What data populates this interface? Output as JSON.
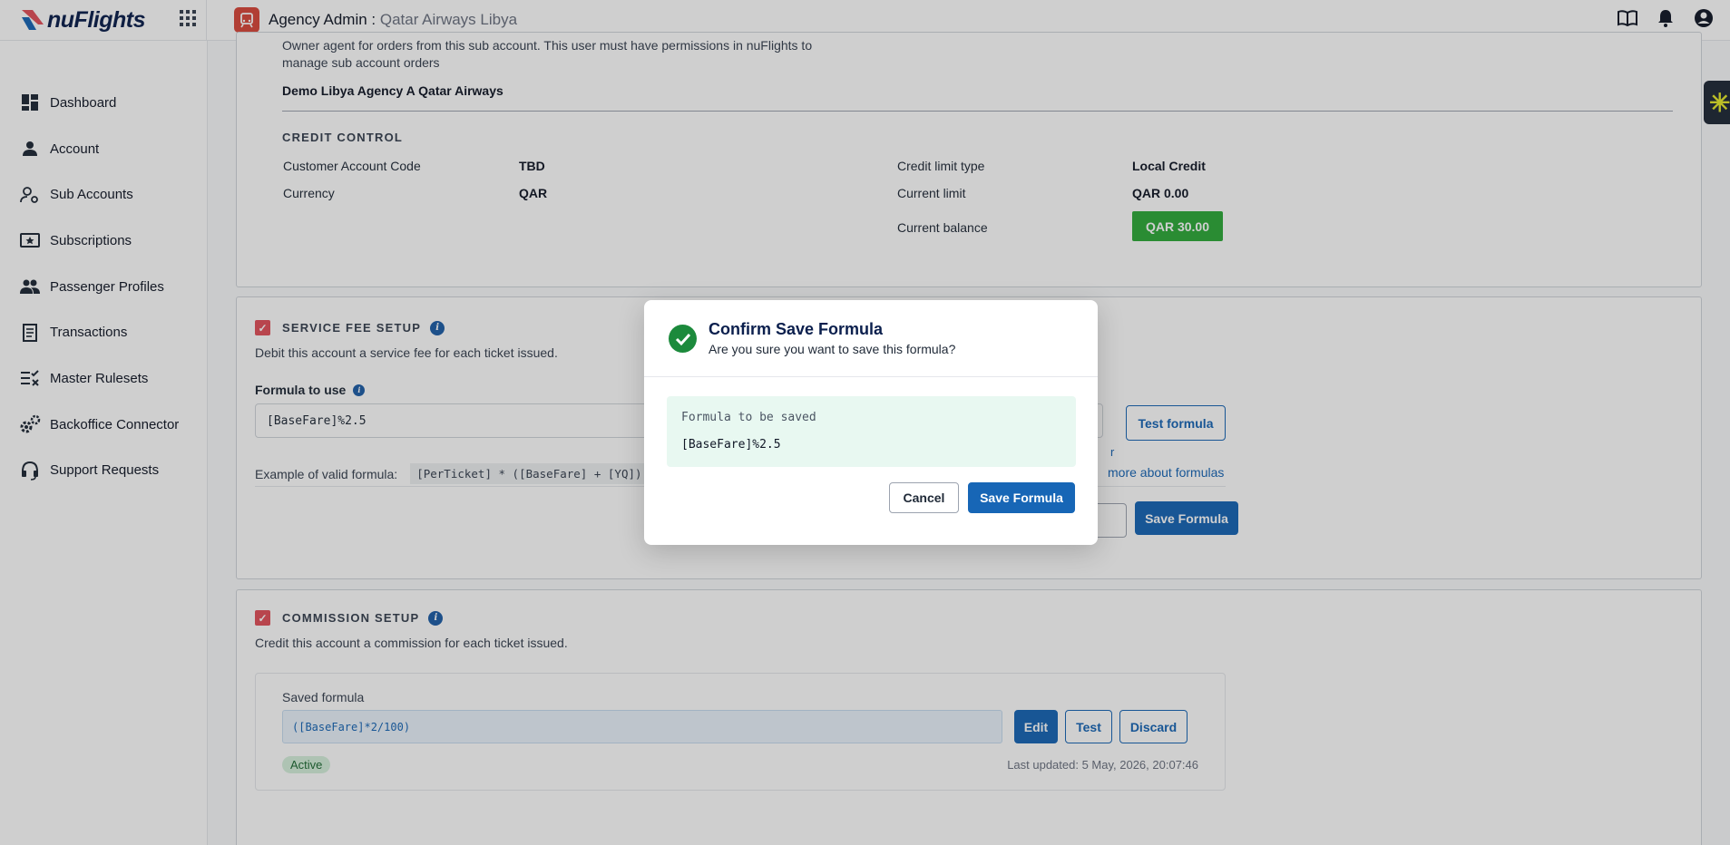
{
  "topbar": {
    "logo_text": "nuFlights",
    "agency_prefix": "Agency Admin :",
    "agency_name": "Qatar Airways Libya",
    "icons": [
      "apps-grid-icon",
      "book-icon",
      "bell-icon",
      "account-circle-icon"
    ]
  },
  "sidebar": {
    "items": [
      {
        "label": "Dashboard",
        "icon": "dashboard-icon"
      },
      {
        "label": "Account",
        "icon": "person-icon"
      },
      {
        "label": "Sub Accounts",
        "icon": "manage-accounts-icon"
      },
      {
        "label": "Subscriptions",
        "icon": "subscriptions-icon"
      },
      {
        "label": "Passenger Profiles",
        "icon": "people-icon"
      },
      {
        "label": "Transactions",
        "icon": "receipt-icon"
      },
      {
        "label": "Master Rulesets",
        "icon": "rules-icon"
      },
      {
        "label": "Backoffice Connector",
        "icon": "settings-connector-icon"
      },
      {
        "label": "Support Requests",
        "icon": "headset-icon"
      }
    ]
  },
  "owner": {
    "description_line1": "Owner agent for orders from this sub account. This user must have permissions in nuFlights to",
    "description_line2": "manage sub account orders",
    "agency_name": "Demo Libya Agency A Qatar Airways"
  },
  "credit_control": {
    "title": "CREDIT CONTROL",
    "customer_account_code_label": "Customer Account Code",
    "customer_account_code_value": "TBD",
    "currency_label": "Currency",
    "currency_value": "QAR",
    "credit_limit_type_label": "Credit limit type",
    "credit_limit_type_value": "Local Credit",
    "current_limit_label": "Current limit",
    "current_limit_value": "QAR 0.00",
    "current_balance_label": "Current balance",
    "current_balance_value": "QAR 30.00"
  },
  "service_fee": {
    "title": "SERVICE FEE SETUP",
    "description": "Debit this account a service fee for each ticket issued.",
    "formula_label": "Formula to use",
    "formula_value": "[BaseFare]%2.5",
    "test_button": "Test formula",
    "link_fragment": "r",
    "example_label": "Example of valid formula:",
    "example_value": "[PerTicket] * ([BaseFare] + [YQ])",
    "learn_more": "more about formulas",
    "save_button": "Save Formula"
  },
  "commission": {
    "title": "COMMISSION SETUP",
    "description": "Credit this account a commission for each ticket issued.",
    "saved_label": "Saved formula",
    "saved_value": "([BaseFare]*2/100)",
    "edit_button": "Edit",
    "test_button": "Test",
    "discard_button": "Discard",
    "status": "Active",
    "last_updated": "Last updated: 5 May, 2026, 20:07:46"
  },
  "modal": {
    "title": "Confirm Save Formula",
    "subtitle": "Are you sure you want to save this formula?",
    "formula_caption": "Formula to be saved",
    "formula_value": "[BaseFare]%2.5",
    "cancel_button": "Cancel",
    "save_button": "Save Formula"
  },
  "colors": {
    "primary": "#1766b6",
    "success": "#2eaa3a",
    "checkbox": "#e2505b",
    "brand_navy": "#0b1f4d"
  }
}
